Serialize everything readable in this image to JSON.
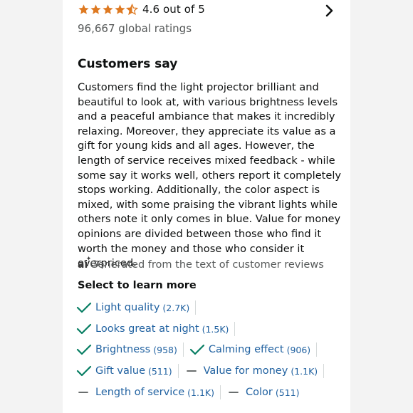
{
  "rating": {
    "value_text": "4.6 out of 5",
    "stars": 4.6,
    "global_ratings": "96,667 global ratings",
    "star_color": "#de7921"
  },
  "customers_say": {
    "heading": "Customers say",
    "summary": "Customers find the light projector brilliant and beautiful to look at, with various brightness levels and a peaceful ambiance that makes it incredibly relaxing. Moreover, they appreciate its value as a gift for young kids and all ages. However, the length of service receives mixed feedback - while some say it works well, others report it completely stops working. Additionally, the color aspect is mixed, with some praising the vibrant lights while others note it only comes in blue. Value for money opinions are divided between those who find it worth the money and those who consider it overpriced.",
    "ai_badge": "ai",
    "ai_note": "Generated from the text of customer reviews"
  },
  "learn_more": {
    "label": "Select to learn more",
    "chips": [
      {
        "label": "Light quality",
        "count": "(2.7K)",
        "sentiment": "positive"
      },
      {
        "label": "Looks great at night",
        "count": "(1.5K)",
        "sentiment": "positive"
      },
      {
        "label": "Brightness",
        "count": "(958)",
        "sentiment": "positive"
      },
      {
        "label": "Calming effect",
        "count": "(906)",
        "sentiment": "positive"
      },
      {
        "label": "Gift value",
        "count": "(511)",
        "sentiment": "positive"
      },
      {
        "label": "Value for money",
        "count": "(1.1K)",
        "sentiment": "mixed"
      },
      {
        "label": "Length of service",
        "count": "(1.1K)",
        "sentiment": "mixed"
      },
      {
        "label": "Color",
        "count": "(511)",
        "sentiment": "mixed"
      }
    ]
  },
  "colors": {
    "link": "#2162a1",
    "check": "#067d62",
    "dash": "#565959"
  }
}
